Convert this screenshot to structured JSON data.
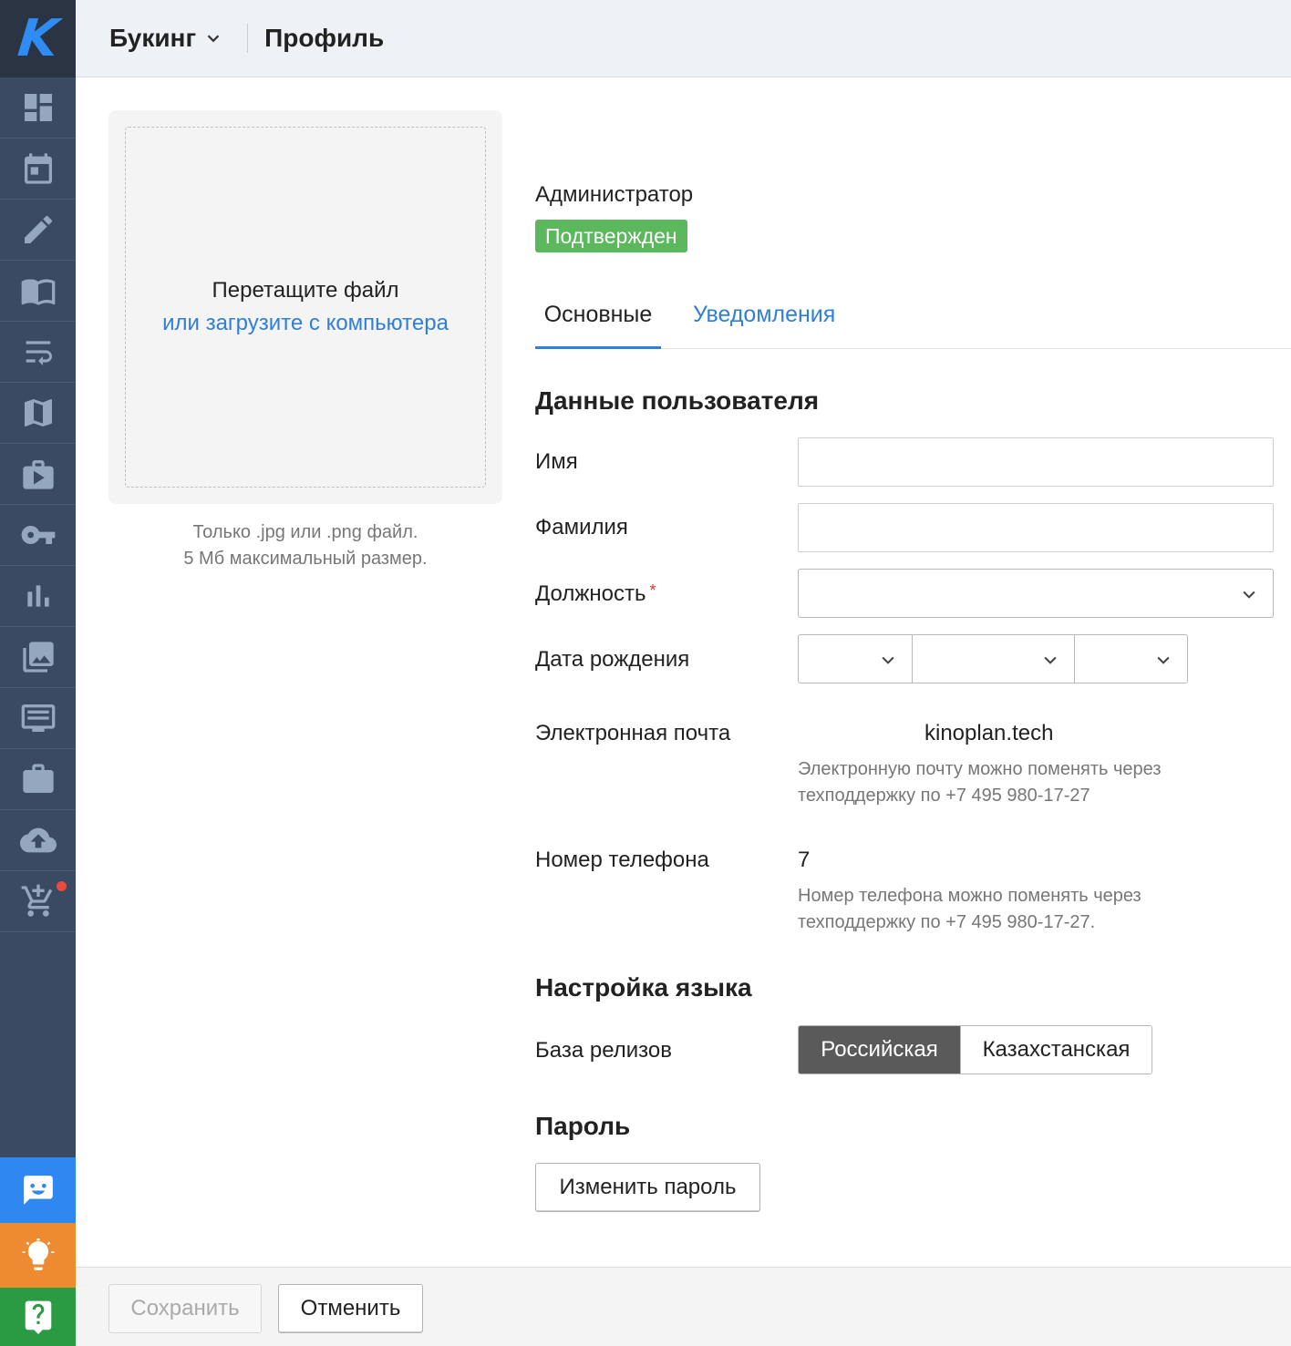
{
  "header": {
    "app_name": "Букинг",
    "page_title": "Профиль"
  },
  "sidebar": {
    "logo": "K",
    "items": [
      {
        "icon": "dashboard-icon"
      },
      {
        "icon": "calendar-icon"
      },
      {
        "icon": "pencil-icon"
      },
      {
        "icon": "book-icon"
      },
      {
        "icon": "wrap-text-icon"
      },
      {
        "icon": "map-icon"
      },
      {
        "icon": "video-bag-icon"
      },
      {
        "icon": "key-icon"
      },
      {
        "icon": "bar-chart-icon"
      },
      {
        "icon": "photo-library-icon"
      },
      {
        "icon": "screen-list-icon"
      },
      {
        "icon": "briefcase-icon"
      },
      {
        "icon": "cloud-upload-icon"
      },
      {
        "icon": "cart-add-icon"
      }
    ],
    "bottom": [
      {
        "icon": "chat-smile-icon",
        "color": "#2f87f0"
      },
      {
        "icon": "lightbulb-icon",
        "color": "#ee8a2f"
      },
      {
        "icon": "help-icon",
        "color": "#2a9a43"
      }
    ]
  },
  "upload": {
    "title": "Перетащите файл",
    "link": "или загрузите с компьютера",
    "hint_line1": "Только .jpg или .png файл.",
    "hint_line2": "5 Мб максимальный размер."
  },
  "profile": {
    "role": "Администратор",
    "status": "Подтвержден",
    "status_color": "#5cb85c"
  },
  "tabs": [
    {
      "label": "Основные",
      "active": true
    },
    {
      "label": "Уведомления",
      "active": false
    }
  ],
  "user_data": {
    "section_title": "Данные пользователя",
    "first_name_label": "Имя",
    "first_name_value": "",
    "last_name_label": "Фамилия",
    "last_name_value": "",
    "position_label": "Должность",
    "position_required": "*",
    "position_value": "",
    "birth_label": "Дата рождения",
    "email_label": "Электронная почта",
    "email_value": "kinoplan.tech",
    "email_hint_line1": "Электронную почту можно поменять через",
    "email_hint_line2": "техподдержку по +7 495 980-17-27",
    "phone_label": "Номер телефона",
    "phone_value": "7",
    "phone_hint_line1": "Номер телефона можно поменять через",
    "phone_hint_line2": "техподдержку по +7 495 980-17-27."
  },
  "language": {
    "section_title": "Настройка языка",
    "release_base_label": "База релизов",
    "options": [
      "Российская",
      "Казахстанская"
    ],
    "selected": "Российская"
  },
  "password": {
    "section_title": "Пароль",
    "change_button": "Изменить пароль"
  },
  "footer": {
    "save_label": "Сохранить",
    "cancel_label": "Отменить"
  },
  "colors": {
    "accent": "#2f7fd8",
    "sidebar": "#3a4a63",
    "required": "#d9342b"
  }
}
